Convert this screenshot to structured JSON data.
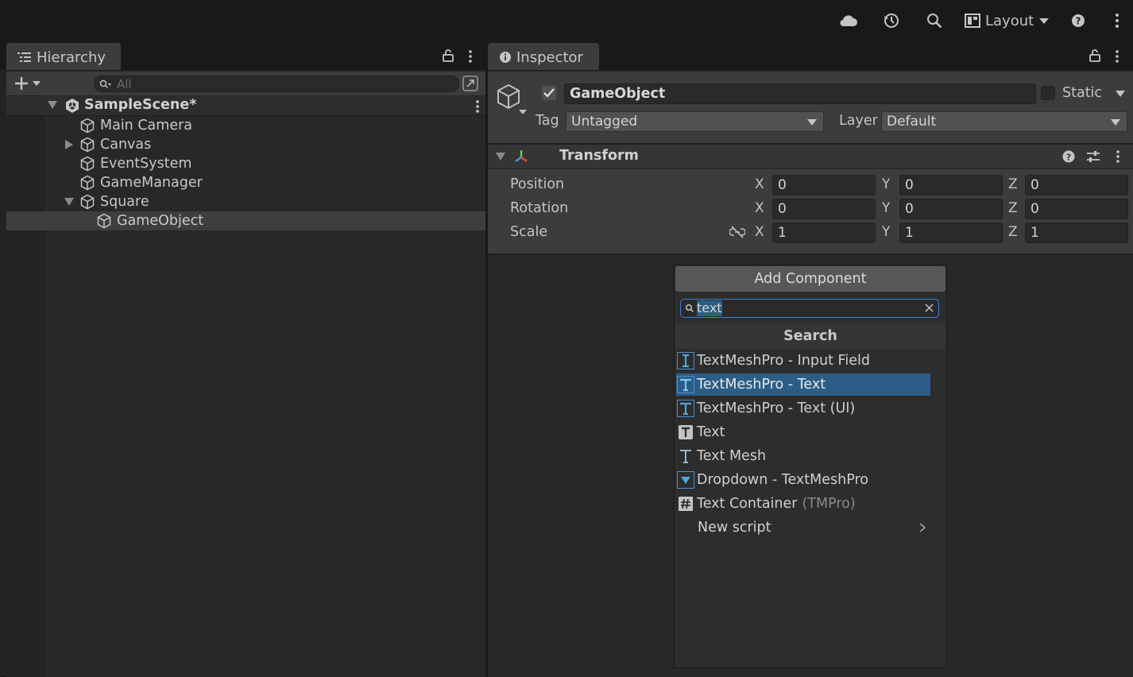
{
  "toolbar": {
    "layout_label": "Layout",
    "icons": [
      "cloud-icon",
      "history-icon",
      "search-icon",
      "layout-icon",
      "help-icon",
      "more-icon"
    ]
  },
  "hierarchy": {
    "tab_label": "Hierarchy",
    "search_placeholder": "All",
    "scene_name": "SampleScene*",
    "items": [
      {
        "label": "Main Camera"
      },
      {
        "label": "Canvas"
      },
      {
        "label": "EventSystem"
      },
      {
        "label": "GameManager"
      },
      {
        "label": "Square"
      },
      {
        "label": "GameObject"
      }
    ]
  },
  "inspector": {
    "tab_label": "Inspector",
    "object_name": "GameObject",
    "static_label": "Static",
    "tag_label": "Tag",
    "tag_value": "Untagged",
    "layer_label": "Layer",
    "layer_value": "Default",
    "transform": {
      "title": "Transform",
      "rows": [
        {
          "label": "Position",
          "x": "0",
          "y": "0",
          "z": "0"
        },
        {
          "label": "Rotation",
          "x": "0",
          "y": "0",
          "z": "0"
        },
        {
          "label": "Scale",
          "x": "1",
          "y": "1",
          "z": "1"
        }
      ],
      "axis_x": "X",
      "axis_y": "Y",
      "axis_z": "Z"
    }
  },
  "add_component": {
    "button_label": "Add Component",
    "search_value": "text",
    "section_title": "Search",
    "items": [
      {
        "label": "TextMeshPro - Input Field",
        "icon": "input-field-icon"
      },
      {
        "label": "TextMeshPro - Text",
        "icon": "tmp-text-icon",
        "selected": true
      },
      {
        "label": "TextMeshPro - Text (UI)",
        "icon": "tmp-text-ui-icon"
      },
      {
        "label": "Text",
        "icon": "text-icon"
      },
      {
        "label": "Text Mesh",
        "icon": "text-mesh-icon"
      },
      {
        "label": "Dropdown - TextMeshPro",
        "icon": "dropdown-icon"
      },
      {
        "label": "Text Container",
        "suffix": "(TMPro)",
        "icon": "script-icon"
      },
      {
        "label": "New script",
        "icon": "chevron-right-icon"
      }
    ]
  },
  "colors": {
    "selection": "#2c5d87",
    "hierarchy_selected": "#3e3e3e",
    "accent_blue": "#4aa8dd"
  }
}
